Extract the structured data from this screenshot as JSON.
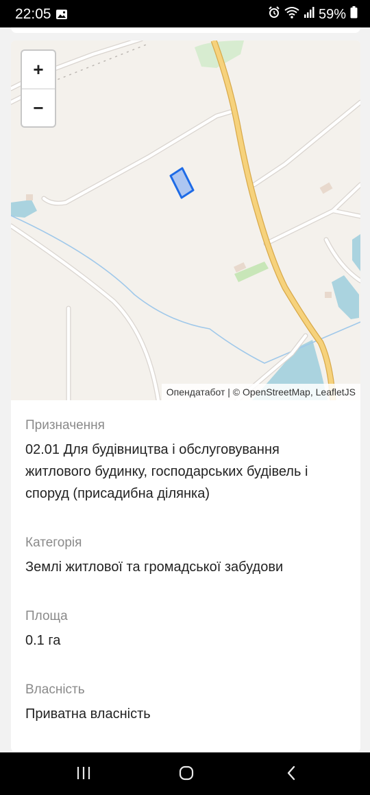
{
  "status_bar": {
    "time": "22:05",
    "battery": "59%",
    "icons": [
      "gallery-icon",
      "alarm-icon",
      "wifi-icon",
      "signal-icon",
      "battery-icon"
    ]
  },
  "map": {
    "zoom_in_label": "+",
    "zoom_out_label": "−",
    "attribution": "Опендатабот | © OpenStreetMap, LeafletJS",
    "colors": {
      "background": "#f4f1ec",
      "main_road": "#f6d27c",
      "road": "#ffffff",
      "water": "#aad3df",
      "parcel_stroke": "#1e6be6",
      "parcel_fill": "#8fb4f3"
    }
  },
  "details": [
    {
      "label": "Призначення",
      "lines": [
        "02.01 Для будівництва і обслуговування",
        "житлового будинку, господарських будівель і",
        "споруд (присадибна ділянка)"
      ]
    },
    {
      "label": "Категорія",
      "lines": [
        "Землі житлової та громадської забудови"
      ]
    },
    {
      "label": "Площа",
      "lines": [
        "0.1 га"
      ]
    },
    {
      "label": "Власність",
      "lines": [
        "Приватна власність"
      ]
    }
  ],
  "nav_bar": {
    "icons": [
      "recents-icon",
      "home-icon",
      "back-icon"
    ]
  }
}
